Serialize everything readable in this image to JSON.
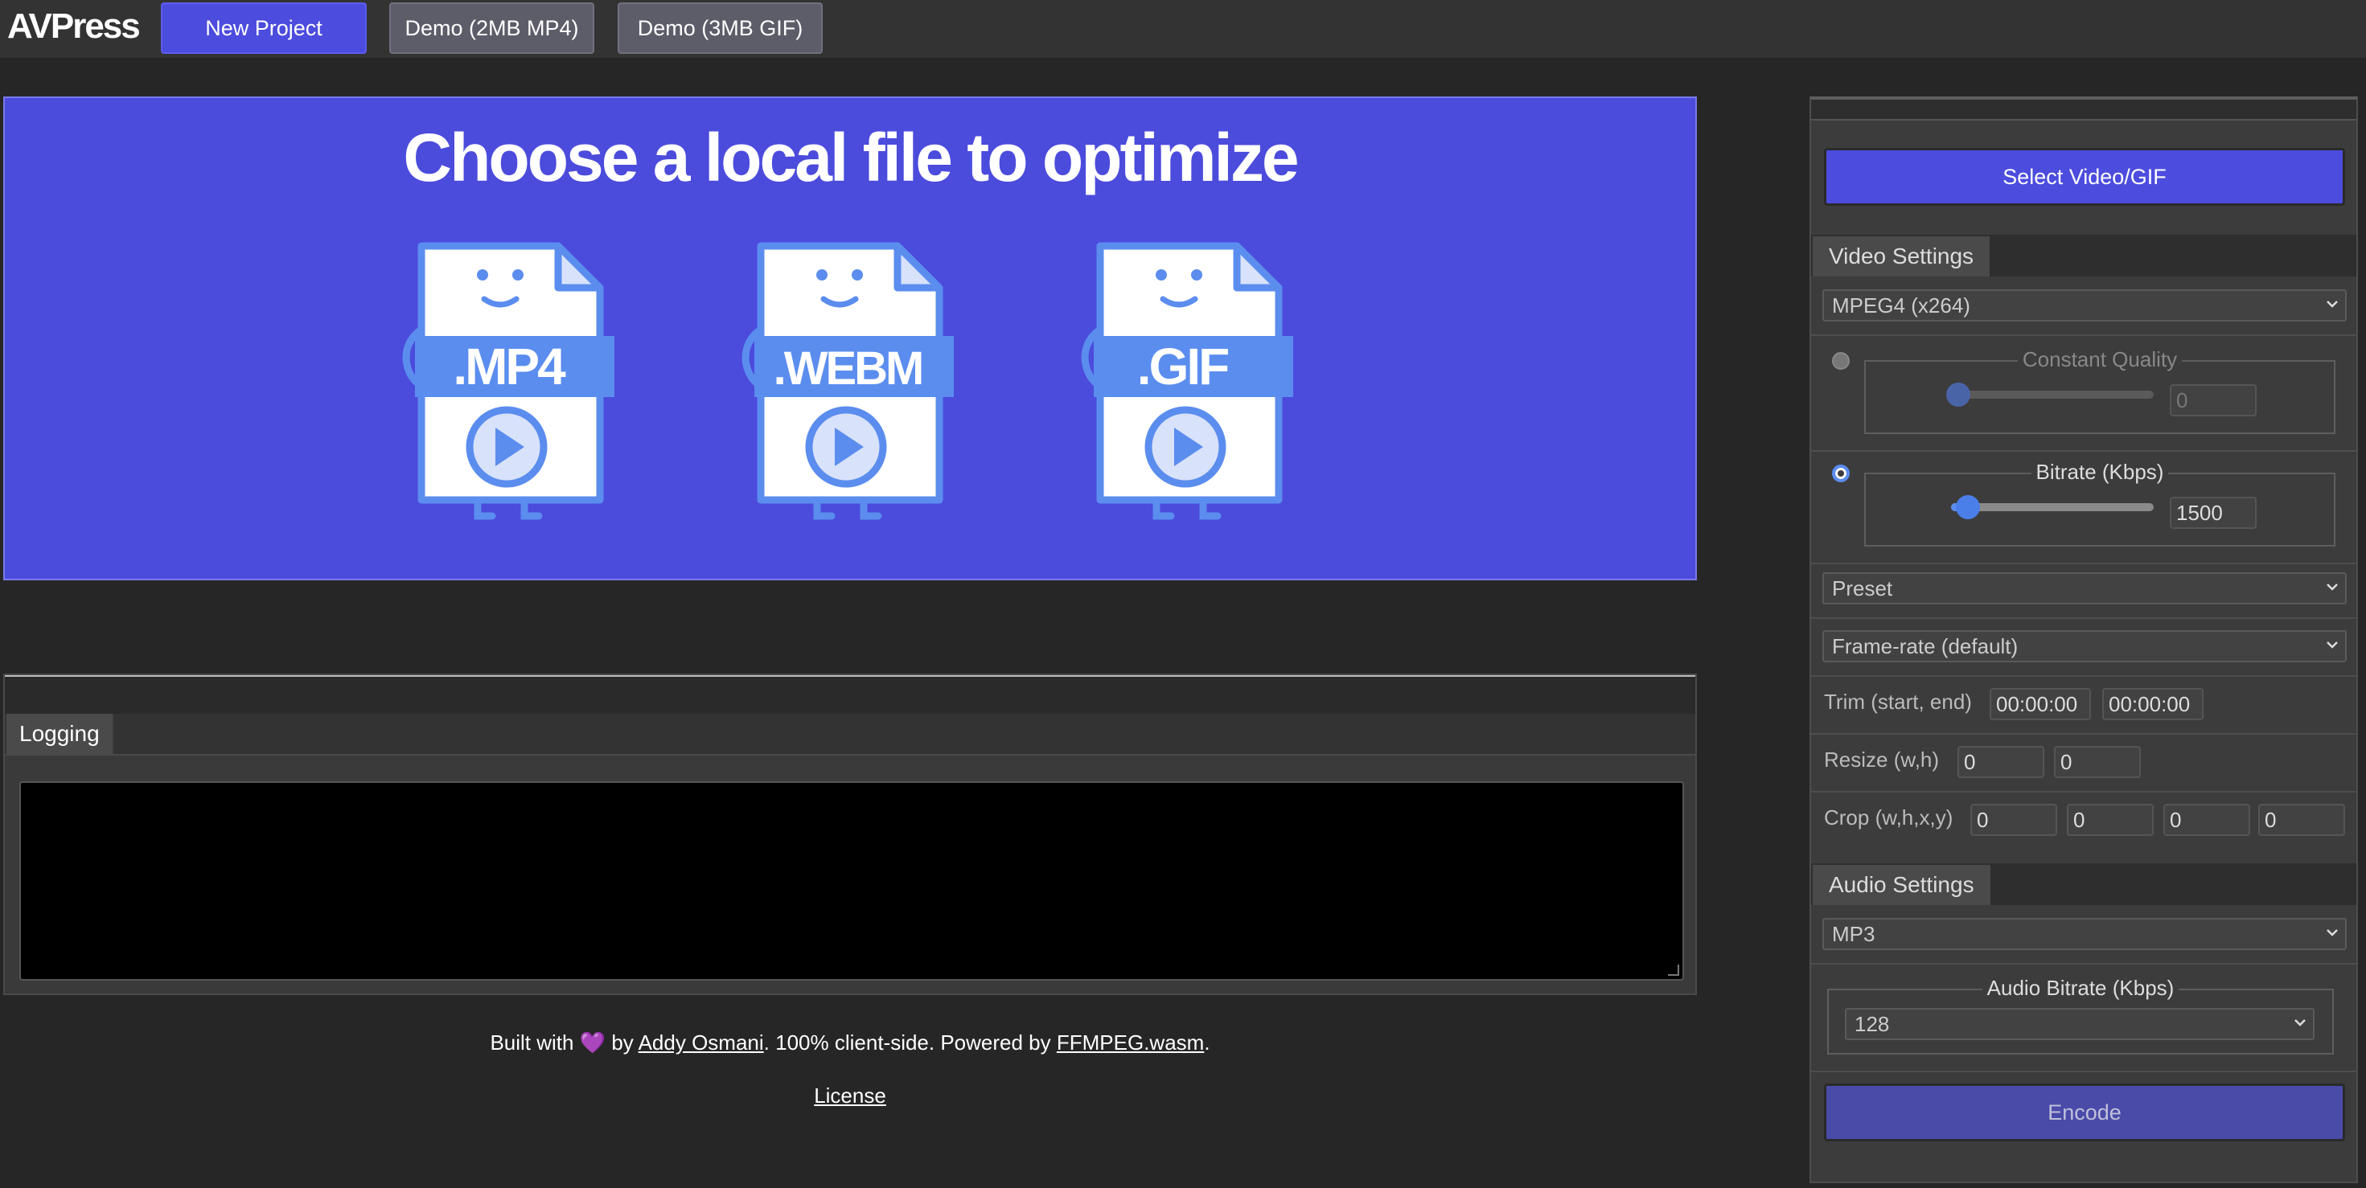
{
  "header": {
    "logo": "AVPress",
    "new_project": "New Project",
    "demo_mp4": "Demo (2MB MP4)",
    "demo_gif": "Demo (3MB GIF)"
  },
  "hero": {
    "title": "Choose a local file to optimize",
    "files": [
      ".MP4",
      ".WEBM",
      ".GIF"
    ]
  },
  "logging": {
    "tab": "Logging",
    "content": ""
  },
  "footer": {
    "built_with": "Built with",
    "heart": "💜",
    "by": "by",
    "author": "Addy Osmani",
    "mid": ". 100% client-side. Powered by",
    "ffmpeg": "FFMPEG.wasm",
    "end": ".",
    "license": "License"
  },
  "sidebar": {
    "select_button": "Select Video/GIF",
    "video_tab": "Video Settings",
    "codec": "MPEG4 (x264)",
    "constant_quality": {
      "label": "Constant Quality",
      "value": "0",
      "selected": false
    },
    "bitrate": {
      "label": "Bitrate (Kbps)",
      "value": "1500",
      "selected": true
    },
    "preset": "Preset",
    "framerate": "Frame-rate (default)",
    "trim": {
      "label": "Trim (start, end)",
      "start": "00:00:00",
      "end": "00:00:00"
    },
    "resize": {
      "label": "Resize (w,h)",
      "w": "0",
      "h": "0"
    },
    "crop": {
      "label": "Crop (w,h,x,y)",
      "w": "0",
      "h": "0",
      "x": "0",
      "y": "0"
    },
    "audio_tab": "Audio Settings",
    "audio_codec": "MP3",
    "audio_bitrate": {
      "label": "Audio Bitrate (Kbps)",
      "value": "128"
    },
    "encode": "Encode"
  },
  "colors": {
    "accent": "#4c4cde",
    "icon_blue": "#5b8def",
    "radio_selected": "#5b8def"
  },
  "icons": [
    "chevron-down-icon",
    "file-mp4-icon",
    "file-webm-icon",
    "file-gif-icon",
    "play-icon"
  ]
}
